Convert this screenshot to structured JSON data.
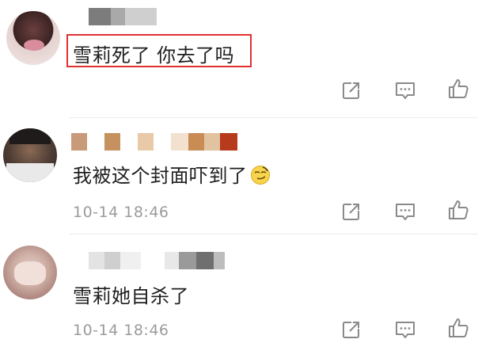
{
  "colors": {
    "highlight_border": "#e03131",
    "timestamp": "#9b9b9b",
    "icon_stroke": "#8a8a8a",
    "text": "#1e1e1e"
  },
  "comments": [
    {
      "text": "雪莉死了 你去了吗",
      "timestamp": "",
      "highlighted": true,
      "actions": [
        "share-icon",
        "comment-icon",
        "like-icon"
      ]
    },
    {
      "text": "我被这个封面吓到了",
      "emoji": "smirk-face-icon",
      "timestamp": "10-14 18:46",
      "highlighted": false,
      "actions": [
        "share-icon",
        "comment-icon",
        "like-icon"
      ]
    },
    {
      "text": "雪莉她自杀了",
      "timestamp": "10-14 18:46",
      "highlighted": false,
      "actions": [
        "share-icon",
        "comment-icon",
        "like-icon"
      ]
    }
  ]
}
